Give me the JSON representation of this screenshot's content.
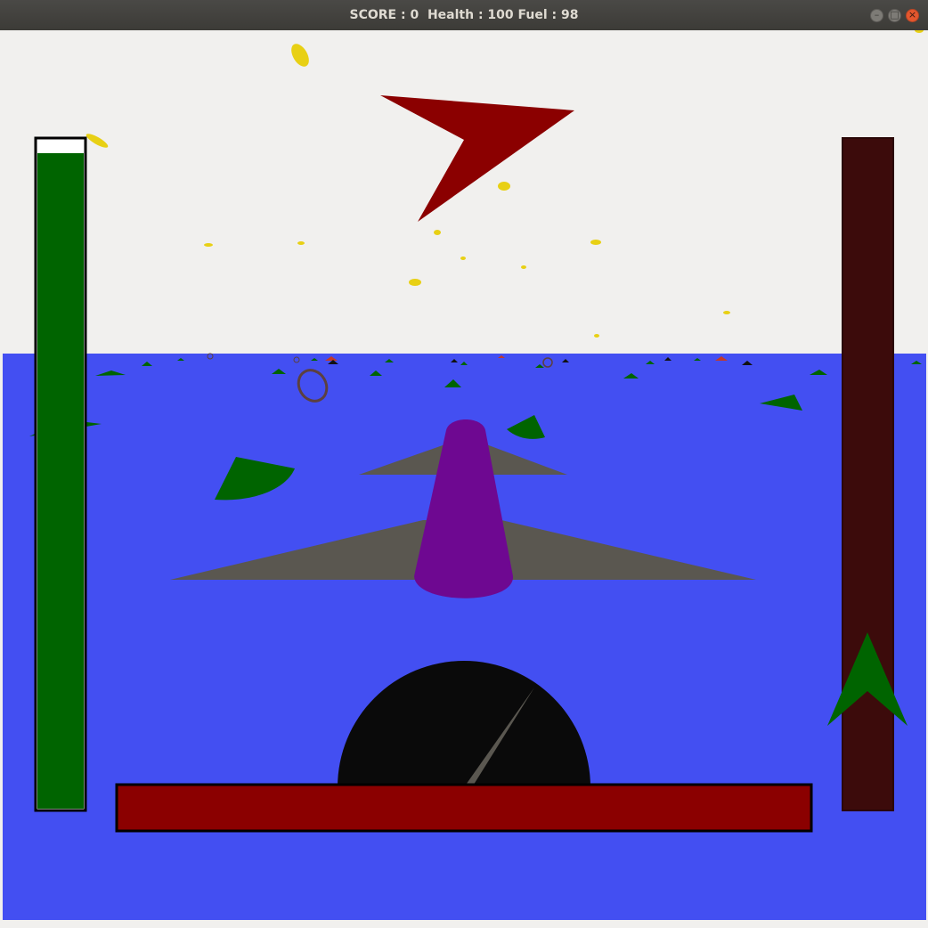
{
  "window": {
    "title": "SCORE : 0  Health : 100 Fuel : 98",
    "buttons": {
      "minimize_icon": "minimize-icon",
      "maximize_icon": "maximize-icon",
      "close_icon": "close-icon"
    }
  },
  "hud": {
    "score": 0,
    "health": 100,
    "fuel": 98,
    "fuel_bar_fraction": 0.98,
    "speed_gauge_fraction": 0.3,
    "altitude_direction": "up-arrow"
  },
  "colors": {
    "sky": "#f1f0ee",
    "sea": "#434ff2",
    "fuel_bar": "#006400",
    "altitude_bar": "#3c0b0b",
    "altitude_arrow": "#006400",
    "health_bar": "#8b0000",
    "compass_arrow": "#8b0000",
    "plane_body": "#6e0891",
    "plane_wings": "#5a5750",
    "speedometer": "#0a0a0a",
    "needle": "#5a5750",
    "islands": "#006400",
    "fuel_pickups": "#e8d014",
    "rings": "#5c4040",
    "title_text": "#dfdbd2",
    "close_button": "#e4572e"
  }
}
